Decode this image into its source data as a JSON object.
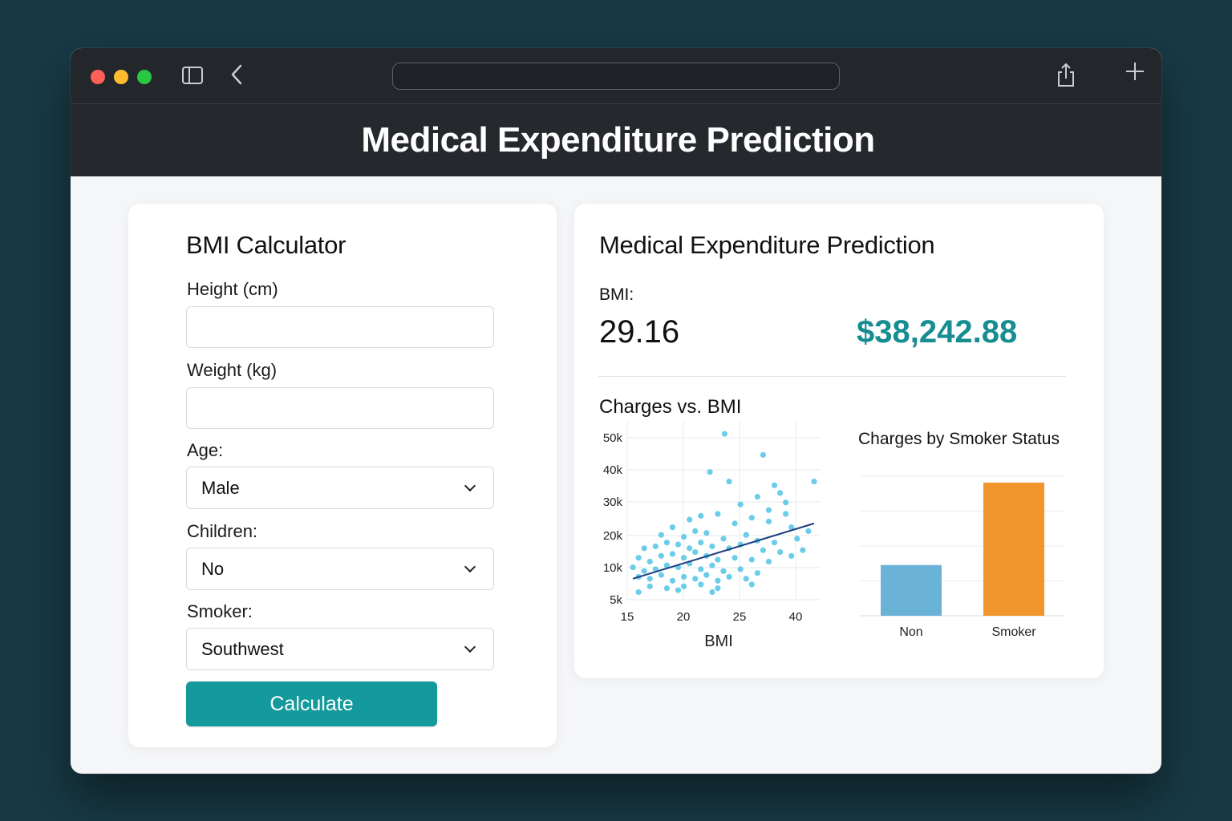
{
  "window": {
    "controls": [
      "close",
      "minimize",
      "maximize"
    ],
    "toolbar_icons": [
      "sidebar-icon",
      "back-icon",
      "share-icon",
      "plus-icon"
    ],
    "address": ""
  },
  "header": {
    "title": "Medical Expenditure Prediction"
  },
  "calculator": {
    "title": "BMI Calculator",
    "height_label": "Height (cm)",
    "height_value": "",
    "weight_label": "Weight (kg)",
    "weight_value": "",
    "age_label": "Age:",
    "age_value": "Male",
    "children_label": "Children:",
    "children_value": "No",
    "smoker_label": "Smoker:",
    "smoker_value": "Southwest",
    "calculate_label": "Calculate"
  },
  "result": {
    "title": "Medical Expenditure Prediction",
    "bmi_label": "BMI:",
    "bmi_value": "29.16",
    "cost_value": "$38,242.88"
  },
  "colors": {
    "accent": "#14999c",
    "cost_text": "#168d90",
    "scatter_points": "#5bc8e6",
    "trend_line": "#1c3f7f",
    "bar_non": "#6ab3d6",
    "bar_smoker": "#f0962d"
  },
  "chart_data": [
    {
      "type": "scatter",
      "title": "Charges vs. BMI",
      "xlabel": "BMI",
      "ylabel": "",
      "x_ticks": [
        "15",
        "20",
        "25",
        "40"
      ],
      "y_ticks": [
        "5k",
        "10k",
        "20k",
        "30k",
        "40k",
        "50k"
      ],
      "xlim": [
        15,
        32
      ],
      "ylim": [
        5000,
        50000
      ],
      "grid": true,
      "trend_line": {
        "x": [
          15.5,
          31.5
        ],
        "y": [
          10500,
          25000
        ]
      },
      "points": [
        {
          "x": 23.6,
          "y": 48500
        },
        {
          "x": 27.0,
          "y": 43000
        },
        {
          "x": 31.5,
          "y": 36000
        },
        {
          "x": 22.3,
          "y": 38500
        },
        {
          "x": 24.0,
          "y": 36000
        },
        {
          "x": 28.0,
          "y": 35000
        },
        {
          "x": 28.5,
          "y": 33000
        },
        {
          "x": 26.5,
          "y": 32000
        },
        {
          "x": 25.0,
          "y": 30000
        },
        {
          "x": 29.0,
          "y": 30500
        },
        {
          "x": 20.5,
          "y": 26000
        },
        {
          "x": 21.5,
          "y": 27000
        },
        {
          "x": 23.0,
          "y": 27500
        },
        {
          "x": 24.5,
          "y": 25000
        },
        {
          "x": 26.0,
          "y": 26500
        },
        {
          "x": 27.5,
          "y": 25500
        },
        {
          "x": 29.5,
          "y": 24000
        },
        {
          "x": 19.0,
          "y": 24000
        },
        {
          "x": 18.0,
          "y": 22000
        },
        {
          "x": 20.0,
          "y": 21500
        },
        {
          "x": 21.0,
          "y": 23000
        },
        {
          "x": 22.0,
          "y": 22500
        },
        {
          "x": 23.5,
          "y": 21000
        },
        {
          "x": 25.5,
          "y": 22000
        },
        {
          "x": 26.5,
          "y": 20500
        },
        {
          "x": 28.0,
          "y": 20000
        },
        {
          "x": 30.0,
          "y": 21000
        },
        {
          "x": 16.5,
          "y": 18500
        },
        {
          "x": 17.5,
          "y": 19000
        },
        {
          "x": 18.5,
          "y": 20000
        },
        {
          "x": 19.5,
          "y": 19500
        },
        {
          "x": 20.5,
          "y": 18500
        },
        {
          "x": 21.5,
          "y": 20000
        },
        {
          "x": 22.5,
          "y": 19000
        },
        {
          "x": 24.0,
          "y": 18500
        },
        {
          "x": 25.0,
          "y": 19500
        },
        {
          "x": 27.0,
          "y": 18000
        },
        {
          "x": 28.5,
          "y": 17500
        },
        {
          "x": 29.5,
          "y": 16500
        },
        {
          "x": 16.0,
          "y": 16000
        },
        {
          "x": 17.0,
          "y": 15000
        },
        {
          "x": 18.0,
          "y": 16500
        },
        {
          "x": 19.0,
          "y": 17000
        },
        {
          "x": 20.0,
          "y": 16000
        },
        {
          "x": 21.0,
          "y": 17500
        },
        {
          "x": 22.0,
          "y": 16500
        },
        {
          "x": 23.0,
          "y": 15500
        },
        {
          "x": 24.5,
          "y": 16000
        },
        {
          "x": 26.0,
          "y": 15500
        },
        {
          "x": 27.5,
          "y": 15000
        },
        {
          "x": 15.5,
          "y": 13500
        },
        {
          "x": 16.5,
          "y": 12500
        },
        {
          "x": 17.5,
          "y": 13000
        },
        {
          "x": 18.5,
          "y": 14000
        },
        {
          "x": 19.5,
          "y": 13500
        },
        {
          "x": 20.5,
          "y": 14500
        },
        {
          "x": 21.5,
          "y": 13000
        },
        {
          "x": 22.5,
          "y": 14000
        },
        {
          "x": 23.5,
          "y": 12500
        },
        {
          "x": 25.0,
          "y": 13000
        },
        {
          "x": 26.5,
          "y": 12000
        },
        {
          "x": 16.0,
          "y": 11000
        },
        {
          "x": 17.0,
          "y": 10500
        },
        {
          "x": 18.0,
          "y": 11500
        },
        {
          "x": 19.0,
          "y": 10000
        },
        {
          "x": 20.0,
          "y": 11000
        },
        {
          "x": 21.0,
          "y": 10500
        },
        {
          "x": 22.0,
          "y": 11500
        },
        {
          "x": 23.0,
          "y": 10000
        },
        {
          "x": 24.0,
          "y": 11000
        },
        {
          "x": 25.5,
          "y": 10500
        },
        {
          "x": 17.0,
          "y": 8500
        },
        {
          "x": 18.5,
          "y": 8000
        },
        {
          "x": 20.0,
          "y": 8500
        },
        {
          "x": 21.5,
          "y": 9000
        },
        {
          "x": 23.0,
          "y": 8000
        },
        {
          "x": 16.0,
          "y": 7000
        },
        {
          "x": 19.5,
          "y": 7500
        },
        {
          "x": 22.5,
          "y": 7000
        },
        {
          "x": 26.0,
          "y": 9000
        },
        {
          "x": 30.5,
          "y": 18000
        },
        {
          "x": 31.0,
          "y": 23000
        },
        {
          "x": 29.0,
          "y": 27500
        },
        {
          "x": 27.5,
          "y": 28500
        }
      ]
    },
    {
      "type": "bar",
      "title": "Charges by Smoker Status",
      "categories": [
        "Non",
        "Smoker"
      ],
      "values": [
        16000,
        42000
      ],
      "ylim": [
        0,
        44000
      ],
      "grid": true,
      "xlabel": "",
      "ylabel": ""
    }
  ]
}
